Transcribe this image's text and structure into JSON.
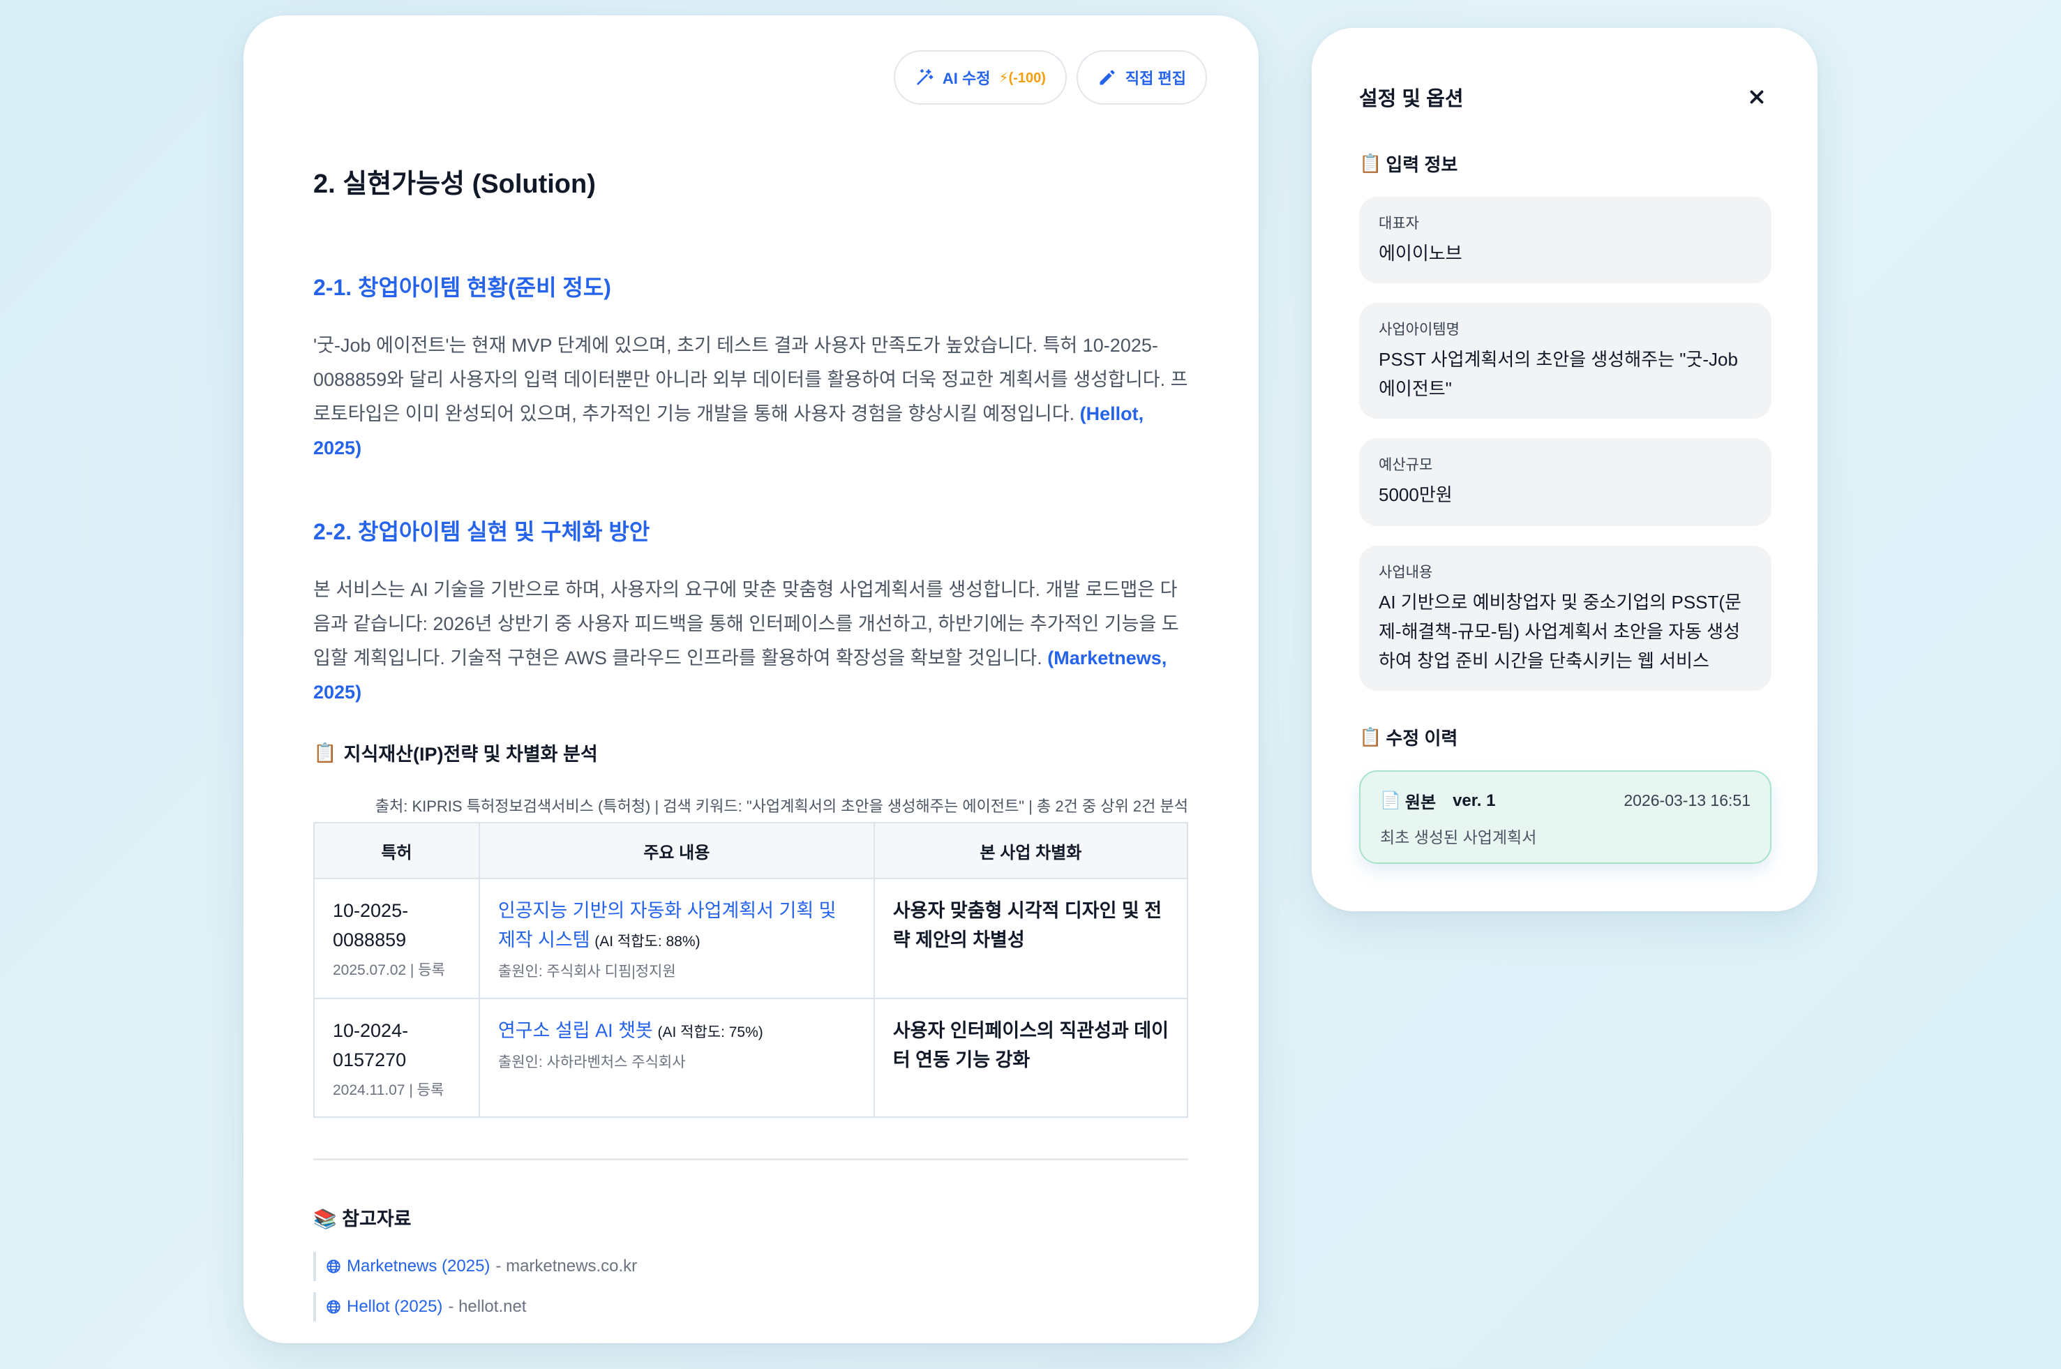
{
  "toolbar": {
    "ai_edit_label": "AI 수정",
    "ai_edit_cost": "(-100)",
    "direct_edit_label": "직접 편집"
  },
  "document": {
    "title": "2. 실현가능성 (Solution)",
    "section1": {
      "heading": "2-1. 창업아이템 현황(준비 정도)",
      "text": "'굿-Job 에이전트'는 현재 MVP 단계에 있으며, 초기 테스트 결과 사용자 만족도가 높았습니다. 특허 10-2025-0088859와 달리 사용자의 입력 데이터뿐만 아니라 외부 데이터를 활용하여 더욱 정교한 계획서를 생성합니다. 프로토타입은 이미 완성되어 있으며, 추가적인 기능 개발을 통해 사용자 경험을 향상시킬 예정입니다. ",
      "citation": "(Hellot, 2025)"
    },
    "section2": {
      "heading": "2-2. 창업아이템 실현 및 구체화 방안",
      "text": "본 서비스는 AI 기술을 기반으로 하며, 사용자의 요구에 맞춘 맞춤형 사업계획서를 생성합니다. 개발 로드맵은 다음과 같습니다: 2026년 상반기 중 사용자 피드백을 통해 인터페이스를 개선하고, 하반기에는 추가적인 기능을 도입할 계획입니다. 기술적 구현은 AWS 클라우드 인프라를 활용하여 확장성을 확보할 것입니다. ",
      "citation": "(Marketnews, 2025)"
    },
    "ip": {
      "icon": "📋",
      "heading": "지식재산(IP)전략 및 차별화 분석",
      "source": "출처: KIPRIS 특허정보검색서비스 (특허청) | 검색 키워드: \"사업계획서의 초안을 생성해주는 에이전트\" | 총 2건 중 상위 2건 분석",
      "columns": [
        "특허",
        "주요 내용",
        "본 사업 차별화"
      ],
      "rows": [
        {
          "number": "10-2025-0088859",
          "date": "2025.07.02 | 등록",
          "title": "인공지능 기반의 자동화 사업계획서 기획 및 제작 시스템",
          "fit": "(AI 적합도: 88%)",
          "applicant": "출원인: 주식회사 디핌|정지원",
          "diff": "사용자 맞춤형 시각적 디자인 및 전략 제안의 차별성"
        },
        {
          "number": "10-2024-0157270",
          "date": "2024.11.07 | 등록",
          "title": "연구소 설립 AI 챗봇",
          "fit": "(AI 적합도: 75%)",
          "applicant": "출원인: 사하라벤처스 주식회사",
          "diff": "사용자 인터페이스의 직관성과 데이터 연동 기능 강화"
        }
      ]
    },
    "references": {
      "icon": "📚",
      "title": "참고자료",
      "items": [
        {
          "label": "Marketnews (2025)",
          "domain": " - marketnews.co.kr"
        },
        {
          "label": "Hellot (2025)",
          "domain": " - hellot.net"
        }
      ]
    }
  },
  "sidebar": {
    "title": "설정 및 옵션",
    "input_section": {
      "icon": "📋",
      "title": "입력 정보"
    },
    "fields": [
      {
        "label": "대표자",
        "value": "에이이노브"
      },
      {
        "label": "사업아이템명",
        "value": "PSST 사업계획서의 초안을 생성해주는 \"굿-Job 에이전트\""
      },
      {
        "label": "예산규모",
        "value": "5000만원"
      },
      {
        "label": "사업내용",
        "value": "AI 기반으로 예비창업자 및 중소기업의 PSST(문제-해결책-규모-팀) 사업계획서 초안을 자동 생성하여 창업 준비 시간을 단축시키는 웹 서비스"
      }
    ],
    "history_section": {
      "icon": "📋",
      "title": "수정 이력"
    },
    "history": [
      {
        "icon": "📄",
        "name": "원본",
        "version": "ver. 1",
        "timestamp": "2026-03-13 16:51",
        "description": "최초 생성된 사업계획서"
      }
    ]
  },
  "colors": {
    "accent": "#2563eb",
    "cost": "#f59e0b",
    "history_bg": "#e8f6f1"
  }
}
